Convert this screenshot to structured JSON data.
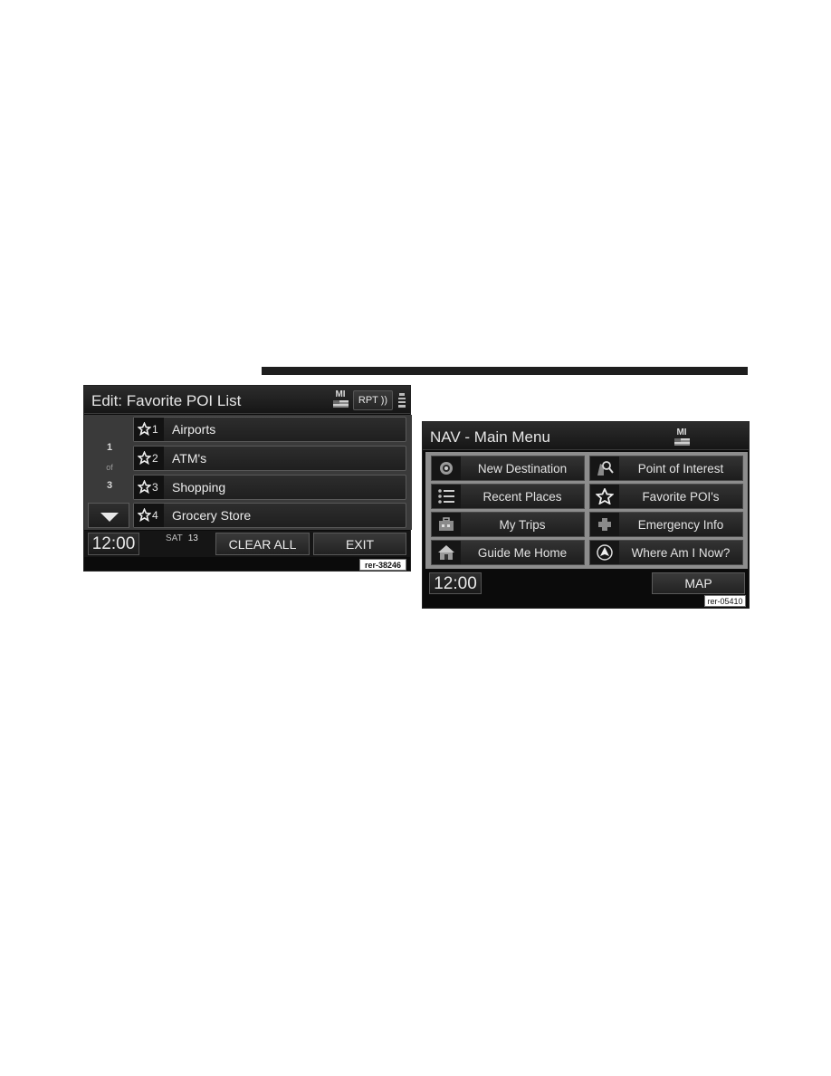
{
  "poi_screen": {
    "title": "Edit: Favorite POI List",
    "units_badge": "MI",
    "rpt_label": "RPT",
    "pager": {
      "current": "1",
      "of_label": "of",
      "total": "3"
    },
    "items": [
      {
        "index": "1",
        "label": "Airports"
      },
      {
        "index": "2",
        "label": "ATM's"
      },
      {
        "index": "3",
        "label": "Shopping"
      },
      {
        "index": "4",
        "label": "Grocery Store"
      }
    ],
    "clock": "12:00",
    "day": "SAT",
    "date": "13",
    "clear_all_label": "CLEAR ALL",
    "exit_label": "EXIT",
    "ref_code": "rer-38246"
  },
  "nav_screen": {
    "title": "NAV - Main Menu",
    "units_badge": "MI",
    "menu": [
      {
        "label": "New Destination",
        "icon": "target-icon"
      },
      {
        "label": "Point of Interest",
        "icon": "poi-search-icon"
      },
      {
        "label": "Recent Places",
        "icon": "list-icon"
      },
      {
        "label": "Favorite POI's",
        "icon": "star-icon"
      },
      {
        "label": "My Trips",
        "icon": "briefcase-icon"
      },
      {
        "label": "Emergency Info",
        "icon": "plus-cross-icon"
      },
      {
        "label": "Guide Me Home",
        "icon": "home-icon"
      },
      {
        "label": "Where Am I Now?",
        "icon": "compass-arrow-icon"
      }
    ],
    "clock": "12:00",
    "map_label": "MAP",
    "ref_code": "rer-05410"
  }
}
